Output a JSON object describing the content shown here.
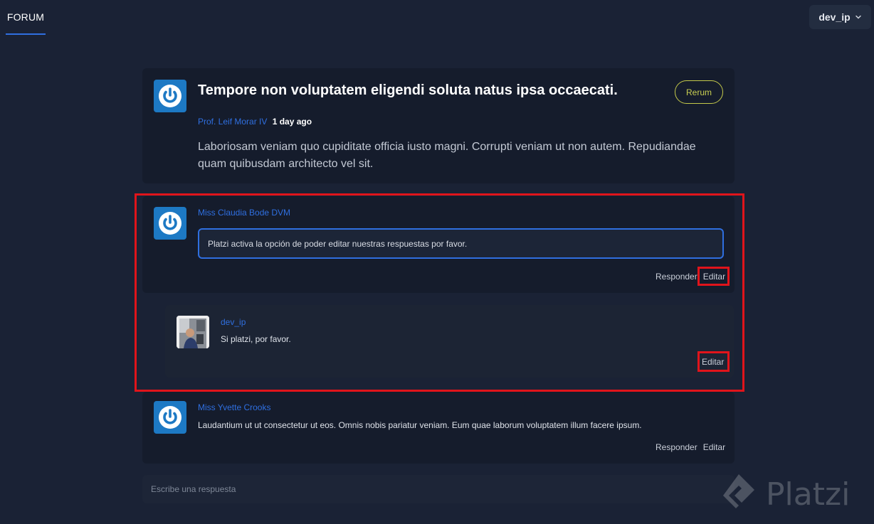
{
  "nav": {
    "tab": "FORUM",
    "username": "dev_ip"
  },
  "question": {
    "title": "Tempore non voluptatem eligendi soluta natus ipsa occaecati.",
    "tag": "Rerum",
    "author": "Prof. Leif Morar IV",
    "time": "1 day ago",
    "body": "Laboriosam veniam quo cupiditate officia iusto magni. Corrupti veniam ut non autem. Repudiandae quam quibusdam architecto vel sit."
  },
  "comments": [
    {
      "author": "Miss Claudia Bode DVM",
      "edit_value": "Platzi activa la opción de poder editar nuestras respuestas por favor.",
      "reply_label": "Responder",
      "edit_label": "Editar",
      "replies": [
        {
          "author": "dev_ip",
          "body": "Si platzi, por favor.",
          "edit_label": "Editar"
        }
      ]
    },
    {
      "author": "Miss Yvette Crooks",
      "body": "Laudantium ut ut consectetur ut eos. Omnis nobis pariatur veniam. Eum quae laborum voluptatem illum facere ipsum.",
      "reply_label": "Responder",
      "edit_label": "Editar"
    }
  ],
  "reply_box": {
    "placeholder": "Escribe una respuesta"
  },
  "watermark": "Platzi",
  "colors": {
    "background": "#1a2235",
    "card": "#151c2c",
    "accent": "#2f6fe0",
    "tag": "#c9cf52",
    "highlight": "#e0141b"
  }
}
